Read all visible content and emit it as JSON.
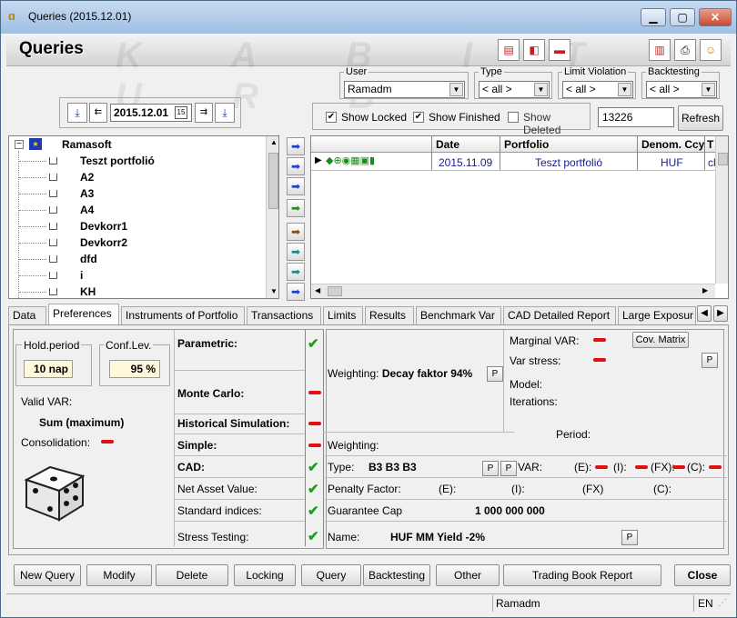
{
  "window": {
    "title": "Queries (2015.12.01)",
    "minimize": "▁",
    "maximize": "▢",
    "close": "✕"
  },
  "header": {
    "title": "Queries",
    "watermark": "K A B I T U R B"
  },
  "date": {
    "value": "2015.12.01"
  },
  "filters": {
    "user": {
      "label": "User",
      "value": "Ramadm"
    },
    "type": {
      "label": "Type",
      "value": "< all >"
    },
    "limit": {
      "label": "Limit Violation",
      "value": "< all >"
    },
    "backtesting": {
      "label": "Backtesting",
      "value": "< all >"
    },
    "show_locked": "Show Locked",
    "show_finished": "Show Finished",
    "show_deleted": "Show Deleted",
    "id_value": "13226",
    "refresh": "Refresh"
  },
  "tree": {
    "root": "Ramasoft",
    "items": [
      "Teszt portfolió",
      "A2",
      "A3",
      "A4",
      "Devkorr1",
      "Devkorr2",
      "dfd",
      "i",
      "KH"
    ]
  },
  "grid": {
    "headers": [
      "Date",
      "Portfolio",
      "Denom. Ccy",
      "T"
    ],
    "row": {
      "date": "2015.11.09",
      "portfolio": "Teszt portfolió",
      "ccy": "HUF",
      "t": "cl"
    }
  },
  "tabs": [
    "Data",
    "Preferences",
    "Instruments of Portfolio",
    "Transactions",
    "Limits",
    "Results",
    "Benchmark Var",
    "CAD Detailed Report",
    "Large Exposur"
  ],
  "prefs": {
    "hold_label": "Hold.period",
    "hold_value": "10 nap",
    "conf_label": "Conf.Lev.",
    "conf_value": "95 %",
    "valid_var": "Valid VAR:",
    "sum": "Sum (maximum)",
    "consolidation": "Consolidation:",
    "parametric": "Parametric:",
    "monte_carlo": "Monte Carlo:",
    "historical": "Historical Simulation:",
    "simple": "Simple:",
    "cad": "CAD:",
    "nav": "Net Asset Value:",
    "std": "Standard indices:",
    "stress": "Stress Testing:",
    "weighting": "Weighting:",
    "decay": "Decay faktor 94%",
    "marginal": "Marginal VAR:",
    "var_stress": "Var stress:",
    "cov": "Cov. Matrix",
    "model": "Model:",
    "iterations": "Iterations:",
    "period": "Period:",
    "weighting2": "Weighting:",
    "type": "Type:",
    "type_val": "B3 B3 B3",
    "var": "VAR:",
    "e": "(E):",
    "i": "(I):",
    "fx": "(FX):",
    "c": "(C):",
    "penalty": "Penalty Factor:",
    "pe": "(E):",
    "pi": "(I):",
    "pfx": "(FX)",
    "pc": "(C):",
    "guarantee": "Guarantee Cap",
    "guarantee_val": "1 000 000 000",
    "name": "Name:",
    "name_val": "HUF MM Yield -2%",
    "p": "P"
  },
  "buttons": [
    "New Query",
    "Modify",
    "Delete",
    "Locking",
    "Query",
    "Backtesting",
    "Other",
    "Trading Book Report",
    "Close"
  ],
  "status": {
    "user": "Ramadm",
    "lang": "EN"
  }
}
